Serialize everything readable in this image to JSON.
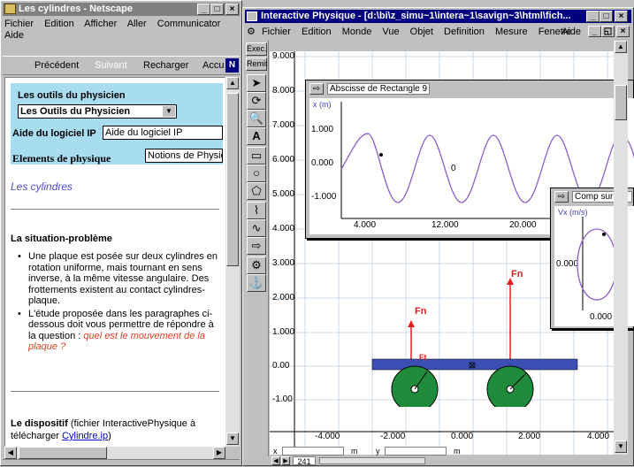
{
  "netscape": {
    "title": "Les cylindres - Netscape",
    "menu": [
      "Fichier",
      "Edition",
      "Afficher",
      "Aller",
      "Communicator"
    ],
    "menu2": "Aide",
    "nav": {
      "back": "Précédent",
      "forward": "Suivant",
      "reload": "Recharger",
      "home": "Accu"
    },
    "tools_heading": "Les outils du physicien",
    "tools_select": "Les Outils du Physicien",
    "help_label": "Aide du logiciel IP",
    "help_value": "Aide du logiciel IP",
    "elements_label": "Elements de physique",
    "elements_value": "Notions de Physic",
    "page_heading": "Les cylindres",
    "situation_heading": "La situation-problème",
    "bullet1": "Une plaque est posée sur deux cylindres en rotation uniforme, mais tournant en sens inverse, à la même vitesse angulaire. Des frottements existent au contact cylindres-plaque.",
    "bullet2_a": "L'étude proposée dans les paragraphes ci-dessous doit vous permettre de répondre à la question :",
    "bullet2_b": "quel est le mouvement de la plaque ?",
    "dispositif_bold": "Le dispositif",
    "dispositif_text": "(fichier InteractivePhysique à télécharger",
    "dispositif_link": "Cylindre.ip",
    "dispositif_end": ")"
  },
  "ip": {
    "title": "Interactive Physique - [d:\\bi\\z_simu~1\\intera~1\\savign~3\\html\\fich...",
    "menu": [
      "Fichier",
      "Edition",
      "Monde",
      "Vue",
      "Objet",
      "Definition",
      "Mesure",
      "Fenetre"
    ],
    "menu_right": "Aide",
    "run": "Exec.",
    "reset": "Remit",
    "y_ticks": [
      "9.000",
      "8.000",
      "7.000",
      "6.000",
      "5.000",
      "4.000",
      "3.000",
      "2.000",
      "1.000",
      "0.00",
      "-1.00"
    ],
    "x_ticks": [
      "-4.000",
      "-2.000",
      "0.000",
      "2.000",
      "4.000"
    ],
    "graph1": {
      "title": "Abscisse de Rectangle 9",
      "ylabel": "x (m)",
      "y_ticks": [
        "1.000",
        "0.000",
        "-1.000"
      ],
      "x_ticks": [
        "4.000",
        "12.000",
        "20.000"
      ],
      "marker": "0"
    },
    "graph2": {
      "title": "Comp sur",
      "ylabel": "Vx (m/s)",
      "y_tick": "0.000",
      "x_tick": "0.000"
    },
    "force1": "Fn",
    "force2": "Fn",
    "friction": "Ft",
    "status": {
      "x_label": "x",
      "x_unit": "m",
      "y_label": "y",
      "y_unit": "m",
      "frame": "241"
    }
  },
  "colors": {
    "title_active": "#000080",
    "title_inactive": "#808080",
    "wheel": "#1e8c3a",
    "plate": "#3c4fb4",
    "force": "#e02020",
    "curve": "#8a5cc8",
    "help_bg": "#a8dcf0"
  }
}
